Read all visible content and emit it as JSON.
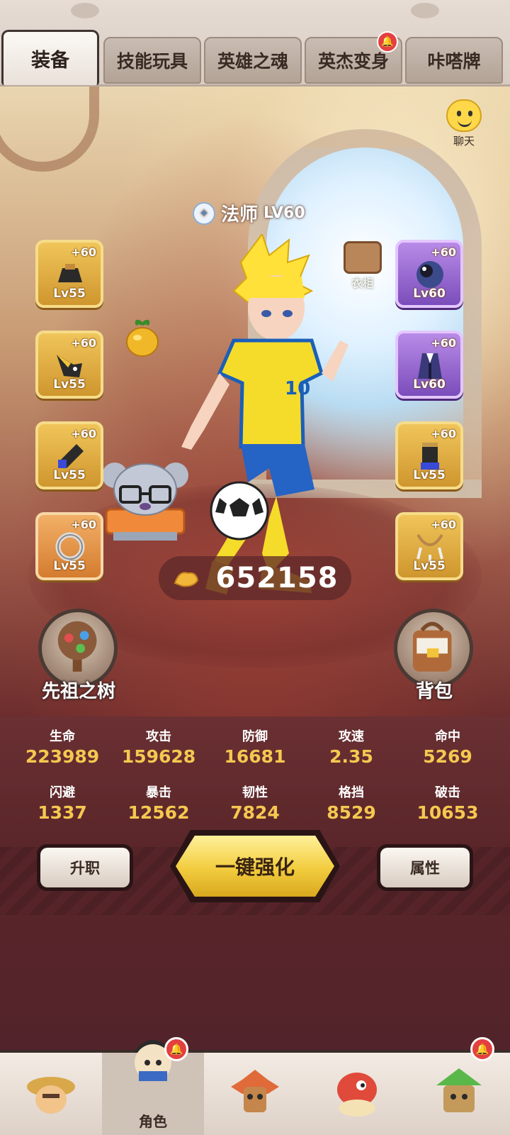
{
  "tabs": [
    {
      "label": "装备",
      "active": true,
      "badge": false
    },
    {
      "label": "技能玩具",
      "active": false,
      "badge": false
    },
    {
      "label": "英雄之魂",
      "active": false,
      "badge": false
    },
    {
      "label": "英杰变身",
      "active": false,
      "badge": true
    },
    {
      "label": "咔嗒牌",
      "active": false,
      "badge": false
    }
  ],
  "chat": {
    "label": "聊天",
    "icon": "smiley-chat-icon"
  },
  "hero": {
    "class": "法师",
    "level": "LV60",
    "class_icon": "mage-class-icon"
  },
  "wardrobe": {
    "label": "衣柜",
    "icon": "wardrobe-icon"
  },
  "equipment_left": [
    {
      "plus": "+60",
      "level": "Lv55",
      "rarity": "gold",
      "icon": "hat-icon"
    },
    {
      "plus": "+60",
      "level": "Lv55",
      "rarity": "gold",
      "icon": "horn-helmet-icon"
    },
    {
      "plus": "+60",
      "level": "Lv55",
      "rarity": "gold",
      "icon": "bracer-icon"
    },
    {
      "plus": "+60",
      "level": "Lv55",
      "rarity": "orange",
      "icon": "ring-icon"
    }
  ],
  "equipment_right": [
    {
      "plus": "+60",
      "level": "Lv60",
      "rarity": "purple",
      "icon": "orb-icon"
    },
    {
      "plus": "+60",
      "level": "Lv60",
      "rarity": "purple",
      "icon": "robe-icon"
    },
    {
      "plus": "+60",
      "level": "Lv55",
      "rarity": "gold",
      "icon": "boots-icon"
    },
    {
      "plus": "+60",
      "level": "Lv55",
      "rarity": "gold",
      "icon": "amulet-icon"
    }
  ],
  "ancestor_tree": {
    "label": "先祖之树",
    "icon": "tree-icon"
  },
  "backpack": {
    "label": "背包",
    "icon": "backpack-icon"
  },
  "power": {
    "value": "652158",
    "icon": "muscle-arm-icon"
  },
  "stats": [
    {
      "name": "生命",
      "value": "223989"
    },
    {
      "name": "攻击",
      "value": "159628"
    },
    {
      "name": "防御",
      "value": "16681"
    },
    {
      "name": "攻速",
      "value": "2.35"
    },
    {
      "name": "命中",
      "value": "5269"
    },
    {
      "name": "闪避",
      "value": "1337"
    },
    {
      "name": "暴击",
      "value": "12562"
    },
    {
      "name": "韧性",
      "value": "7824"
    },
    {
      "name": "格挡",
      "value": "8529"
    },
    {
      "name": "破击",
      "value": "10653"
    }
  ],
  "buttons": {
    "promote": "升职",
    "enhance_all": "一键强化",
    "attributes": "属性"
  },
  "bottom_nav": [
    {
      "label": "",
      "icon": "straw-hat-character-icon",
      "active": false,
      "badge": false
    },
    {
      "label": "角色",
      "icon": "hero-character-icon",
      "active": true,
      "badge": true
    },
    {
      "label": "",
      "icon": "totem-character-icon",
      "active": false,
      "badge": false
    },
    {
      "label": "",
      "icon": "dino-character-icon",
      "active": false,
      "badge": false
    },
    {
      "label": "",
      "icon": "green-totem-character-icon",
      "active": false,
      "badge": true
    }
  ],
  "colors": {
    "stat_value": "#f5c850",
    "gold_slot": "#e3b048",
    "purple_slot": "#9a6bd4",
    "badge": "#e44040"
  }
}
